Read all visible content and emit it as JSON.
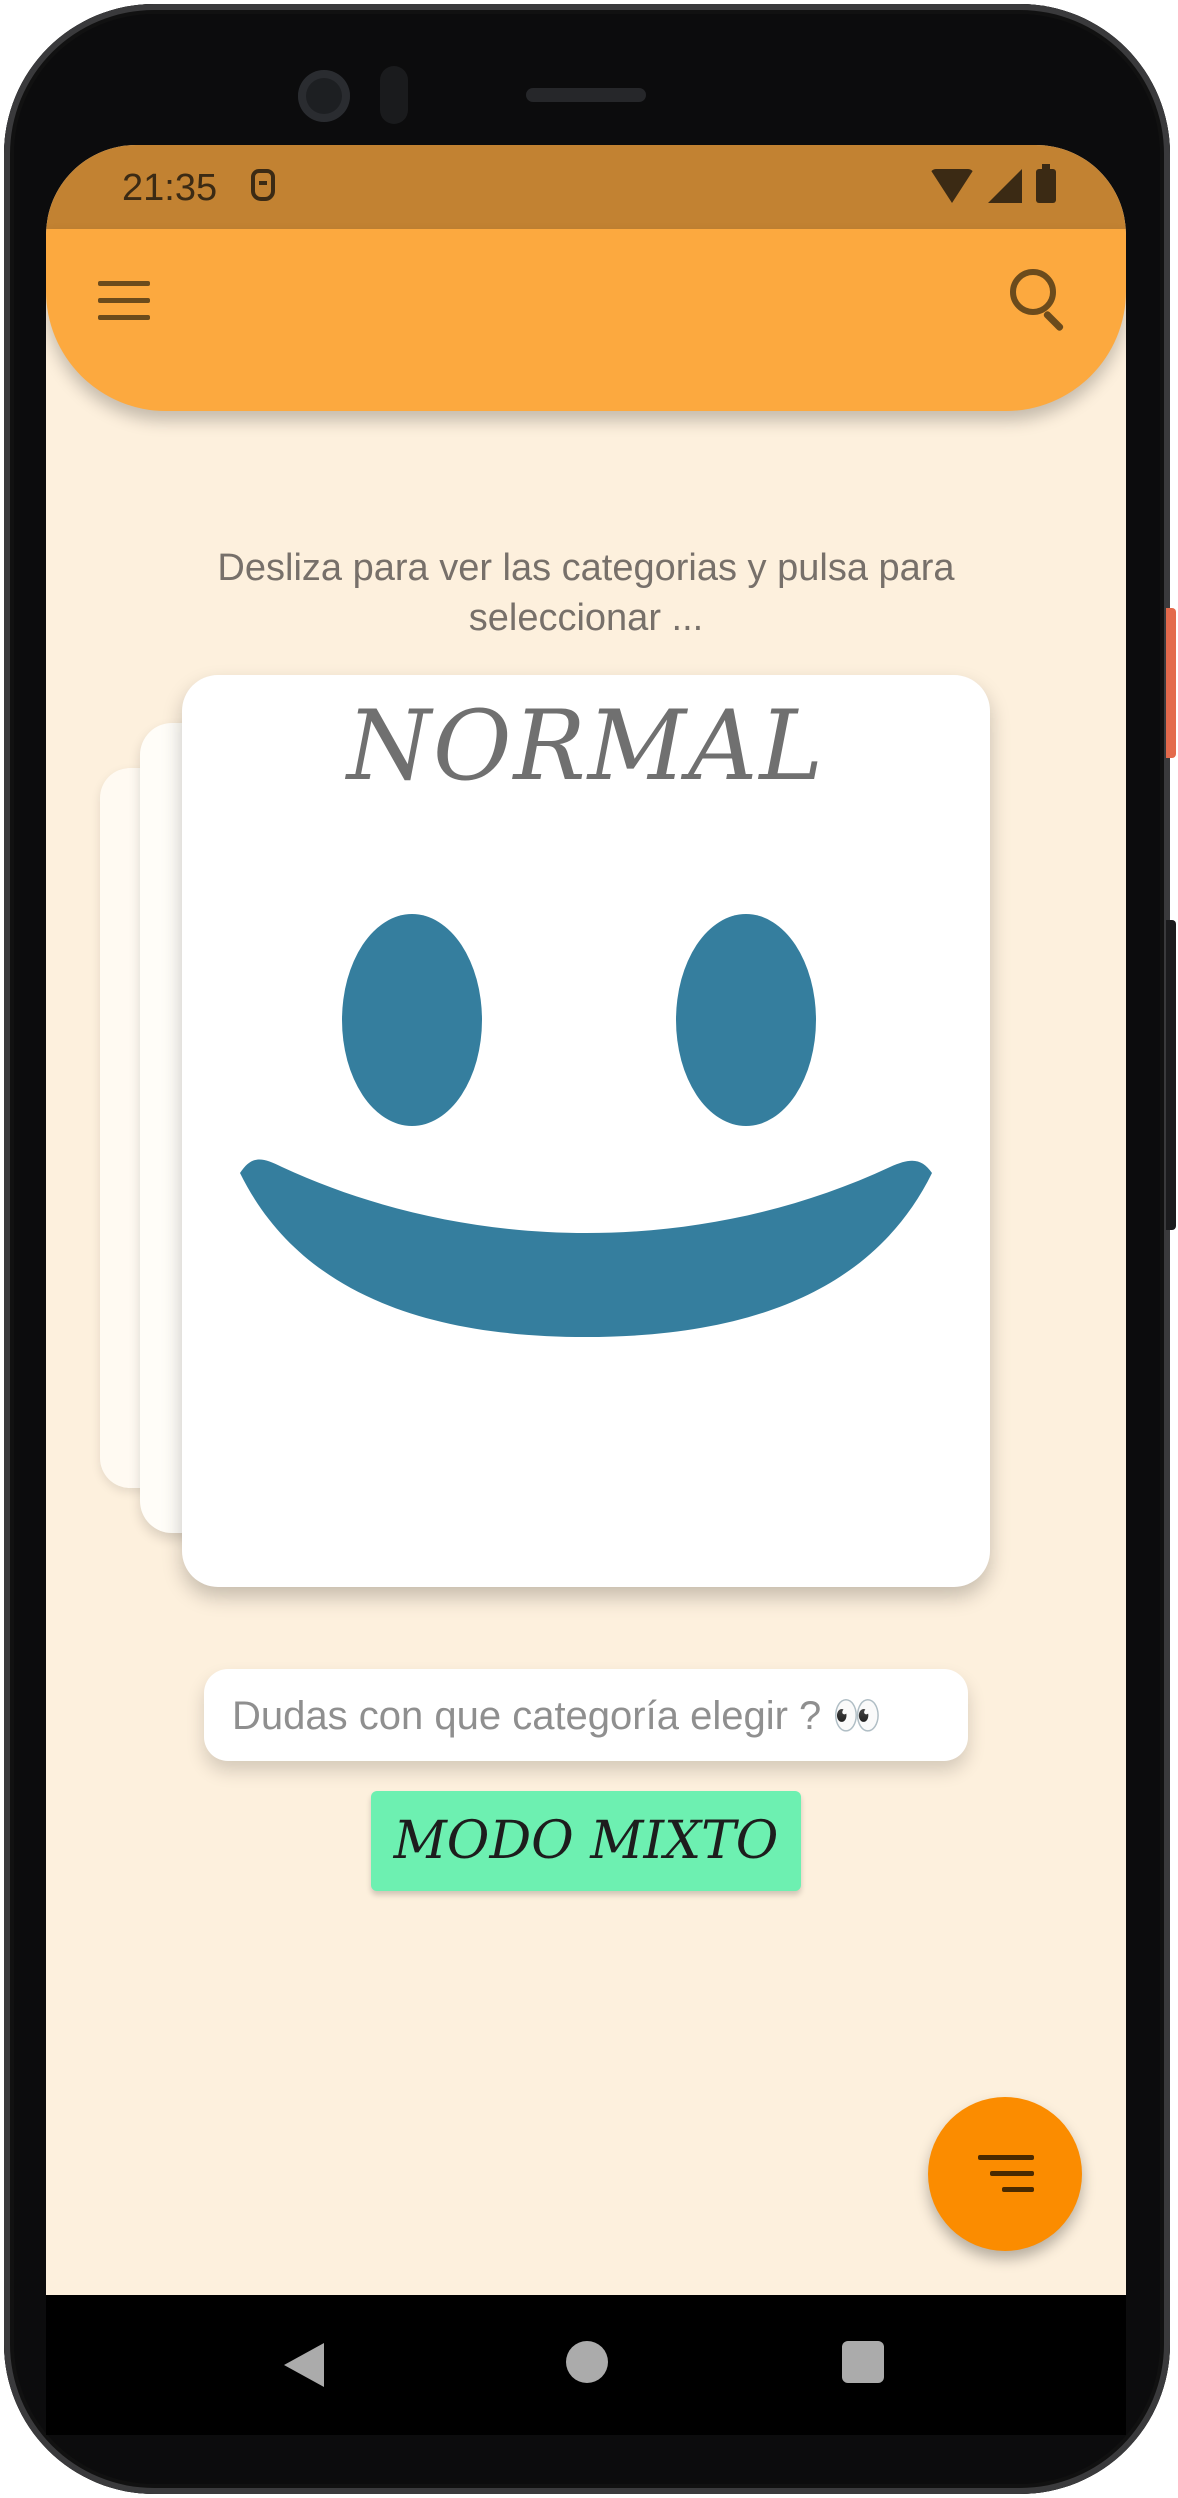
{
  "status_bar": {
    "time": "21:35"
  },
  "instructions": "Desliza para ver las categorias y pulsa para seleccionar ...",
  "category_card": {
    "title": "NORMAL"
  },
  "hint": {
    "text": "Dudas con que categoría elegir ?  👀"
  },
  "mode_button": {
    "label": "MODO MIXTO"
  },
  "colors": {
    "appbar": "#fca93f",
    "statusbar": "#c28232",
    "background": "#fdf0dd",
    "smiley": "#357e9e",
    "mode_button": "#6df0b1",
    "fab": "#fb8c00"
  }
}
